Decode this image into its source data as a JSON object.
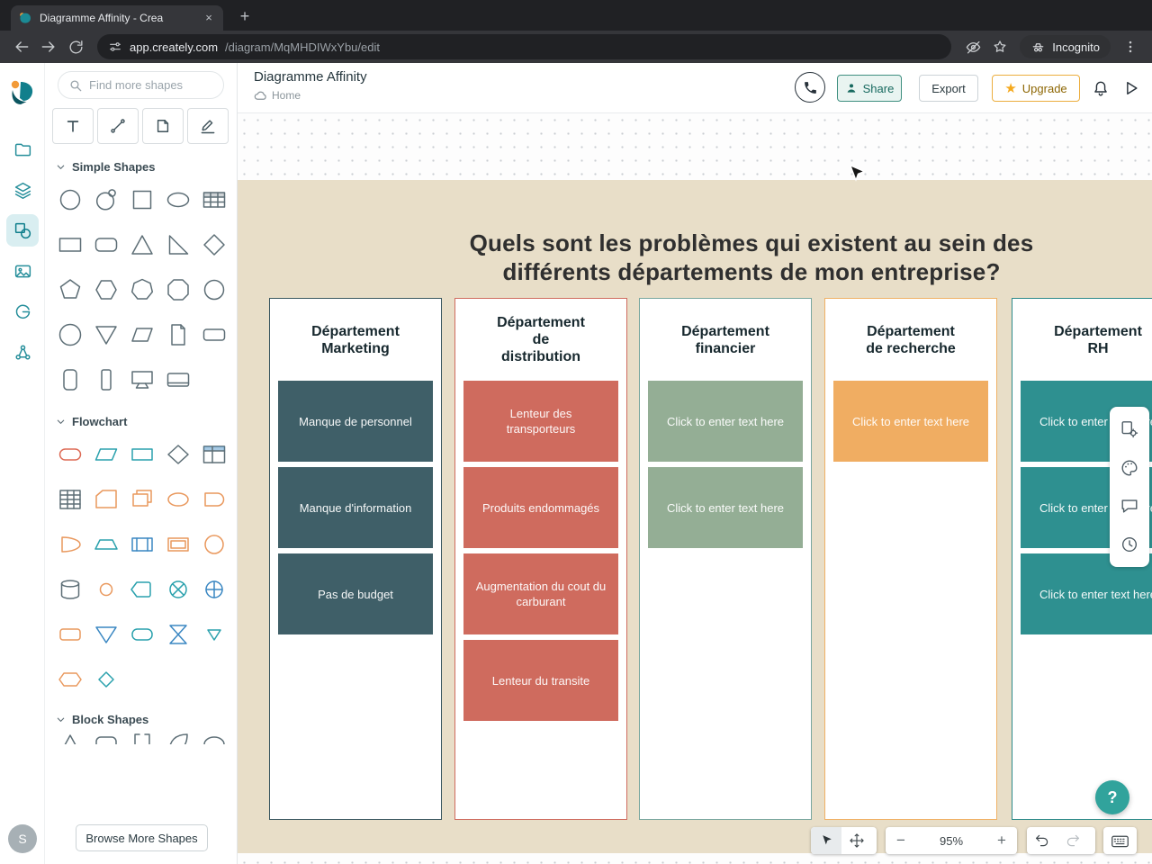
{
  "browser": {
    "tab_title": "Diagramme Affinity - Crea",
    "tab_close": "×",
    "new_tab": "+",
    "url_host": "app.creately.com",
    "url_path": "/diagram/MqMHDIWxYbu/edit",
    "incognito_label": "Incognito"
  },
  "panel": {
    "search_placeholder": "Find more shapes",
    "section_simple": "Simple Shapes",
    "section_flowchart": "Flowchart",
    "section_block": "Block Shapes",
    "browse_more": "Browse More Shapes",
    "avatar_initial": "S"
  },
  "header": {
    "title": "Diagramme Affinity",
    "home": "Home",
    "share": "Share",
    "export": "Export",
    "upgrade": "Upgrade",
    "upgrade_star": "★"
  },
  "board": {
    "question": "Quels sont les problèmes qui existent au sein des\ndifférents départements de mon entreprise?",
    "columns": [
      {
        "title": "Département\nMarketing",
        "border": "#3a5860",
        "note_bg": "#3f5f68",
        "notes": [
          "Manque de personnel",
          "Manque d'information",
          "Pas de budget"
        ]
      },
      {
        "title": "Département\nde\ndistribution",
        "border": "#cf6b5e",
        "note_bg": "#cf6b5e",
        "notes": [
          "Lenteur des transporteurs",
          "Produits endommagés",
          "Augmentation du cout du carburant",
          "Lenteur du transite"
        ]
      },
      {
        "title": "Département\nfinancier",
        "border": "#79a79f",
        "note_bg": "#94ae95",
        "notes": [
          "Click to enter text here",
          "Click to enter text here"
        ]
      },
      {
        "title": "Département\nde recherche",
        "border": "#f0b165",
        "note_bg": "#f0ad62",
        "notes": [
          "Click to enter text here"
        ]
      },
      {
        "title": "Département\nRH",
        "border": "#2c8a8a",
        "note_bg": "#2e9090",
        "notes": [
          "Click to enter text here",
          "Click to enter text here",
          "Click to enter text here"
        ]
      }
    ]
  },
  "footer": {
    "zoom": "95%",
    "help": "?"
  },
  "colors": {
    "canvas_background_shape": "#e8dec8",
    "accent_teal": "#1f8f9b",
    "upgrade_orange": "#ecae3e"
  }
}
